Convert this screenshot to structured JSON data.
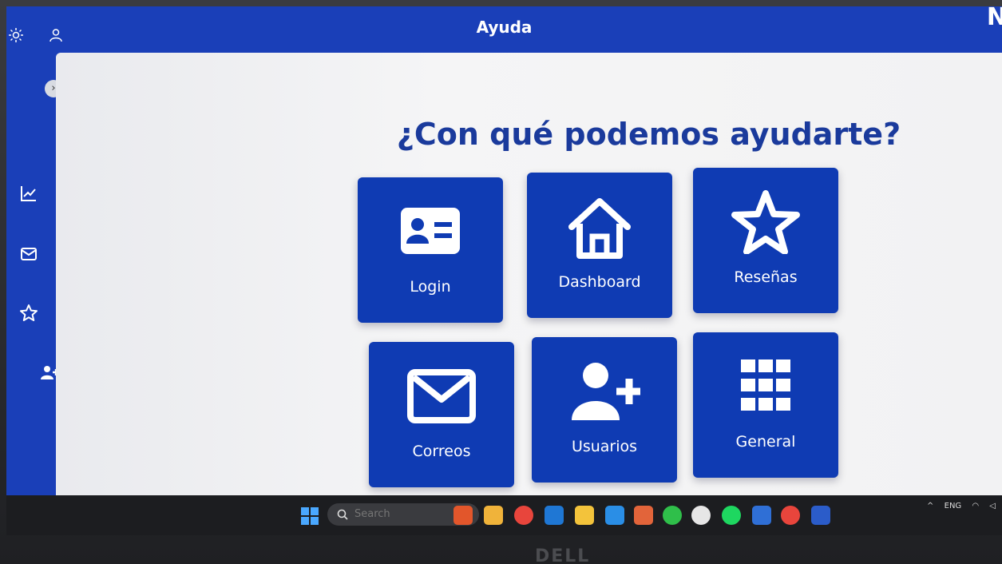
{
  "window": {
    "title": "Ayuda",
    "corner_text": "N"
  },
  "topbar": {
    "icons": [
      "sun-icon",
      "user-icon"
    ]
  },
  "sidebar": {
    "items": [
      {
        "icon": "chart-line-icon"
      },
      {
        "icon": "mail-icon"
      },
      {
        "icon": "star-icon"
      },
      {
        "icon": "user-add-icon"
      }
    ],
    "collapse_label": "›"
  },
  "main": {
    "heading": "¿Con qué podemos ayudarte?",
    "cards": [
      {
        "label": "Login",
        "icon": "id-card-icon"
      },
      {
        "label": "Dashboard",
        "icon": "home-icon"
      },
      {
        "label": "Reseñas",
        "icon": "star-icon"
      },
      {
        "label": "Correos",
        "icon": "mail-icon"
      },
      {
        "label": "Usuarios",
        "icon": "user-add-icon"
      },
      {
        "label": "General",
        "icon": "grid-icon"
      }
    ]
  },
  "taskbar": {
    "search_placeholder": "Search",
    "tray": {
      "chevron": "^",
      "language": "ENG"
    }
  },
  "brand": "DELL",
  "colors": {
    "primary": "#1a3fb8",
    "card": "#0f3bb3",
    "heading": "#1a3a9c",
    "panel": "#f2f2f3"
  }
}
